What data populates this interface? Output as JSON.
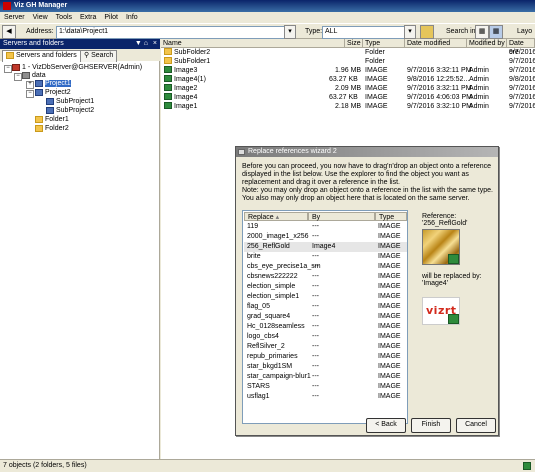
{
  "window": {
    "title": "Viz GH Manager"
  },
  "menu": [
    "Server",
    "View",
    "Tools",
    "Extra",
    "Pilot",
    "Info"
  ],
  "toolbar": {
    "address_label": "Address:",
    "address_value": "1:\\data\\Project1",
    "type_label": "Type:",
    "type_value": "ALL",
    "search_label": "Search in:",
    "layout_label": "Layo"
  },
  "left_panel": {
    "header": "Servers and folders",
    "tabs": [
      "Servers and folders",
      "Search"
    ],
    "tree": [
      {
        "label": "1 - VizDbServer@GHSERVER(Admin)"
      },
      {
        "label": "data"
      },
      {
        "label": "Project1"
      },
      {
        "label": "Project2"
      },
      {
        "label": "SubProject1"
      },
      {
        "label": "SubProject2"
      },
      {
        "label": "Folder1"
      },
      {
        "label": "Folder2"
      }
    ]
  },
  "file_list": {
    "columns": [
      "Name",
      "Size",
      "Type",
      "Date modified",
      "Modified by",
      "Date cre"
    ],
    "rows": [
      {
        "name": "SubFolder2",
        "size": "",
        "type": "Folder",
        "date": "",
        "by": "",
        "created": "9/7/2016"
      },
      {
        "name": "SubFolder1",
        "size": "",
        "type": "Folder",
        "date": "",
        "by": "",
        "created": "9/7/2016"
      },
      {
        "name": "Image3",
        "size": "1.96 MB",
        "type": "IMAGE",
        "date": "9/7/2016 3:32:11 PM",
        "by": "Admin",
        "created": "9/7/2016"
      },
      {
        "name": "Image4(1)",
        "size": "63.27 KB",
        "type": "IMAGE",
        "date": "9/8/2016 12:25:52...",
        "by": "Admin",
        "created": "9/8/2016"
      },
      {
        "name": "Image2",
        "size": "2.09 MB",
        "type": "IMAGE",
        "date": "9/7/2016 3:32:11 PM",
        "by": "Admin",
        "created": "9/7/2016"
      },
      {
        "name": "Image4",
        "size": "63.27 KB",
        "type": "IMAGE",
        "date": "9/7/2016 4:06:03 PM",
        "by": "Admin",
        "created": "9/7/2016"
      },
      {
        "name": "Image1",
        "size": "2.18 MB",
        "type": "IMAGE",
        "date": "9/7/2016 3:32:10 PM",
        "by": "Admin",
        "created": "9/7/2016"
      }
    ]
  },
  "dialog": {
    "title": "Replace references wizard 2",
    "text1": "Before you can proceed, you now have to drag'n'drop an object onto a reference displayed in the list below. Use the explorer to find the object you want as replacement and drag it over a reference in the list.",
    "text2": "Note: you may only drop an object onto a reference in the list with the same type.",
    "text3": "You also may only drop an object here that is located on the same server.",
    "columns": [
      "Replace",
      "By",
      "Type"
    ],
    "rows": [
      {
        "replace": "119",
        "by": "---",
        "type": "IMAGE"
      },
      {
        "replace": "2000_image1_x256",
        "by": "---",
        "type": "IMAGE"
      },
      {
        "replace": "256_ReflGold",
        "by": "Image4",
        "type": "IMAGE"
      },
      {
        "replace": "brite",
        "by": "---",
        "type": "IMAGE"
      },
      {
        "replace": "cbs_eye_precise1a_sm",
        "by": "---",
        "type": "IMAGE"
      },
      {
        "replace": "cbsnews222222",
        "by": "---",
        "type": "IMAGE"
      },
      {
        "replace": "election_simple",
        "by": "---",
        "type": "IMAGE"
      },
      {
        "replace": "election_simple1",
        "by": "---",
        "type": "IMAGE"
      },
      {
        "replace": "flag_05",
        "by": "---",
        "type": "IMAGE"
      },
      {
        "replace": "grad_square4",
        "by": "---",
        "type": "IMAGE"
      },
      {
        "replace": "Hc_0128seamless",
        "by": "---",
        "type": "IMAGE"
      },
      {
        "replace": "logo_cbs4",
        "by": "---",
        "type": "IMAGE"
      },
      {
        "replace": "ReflSilver_2",
        "by": "---",
        "type": "IMAGE"
      },
      {
        "replace": "repub_primaries",
        "by": "---",
        "type": "IMAGE"
      },
      {
        "replace": "star_bkgd1SM",
        "by": "---",
        "type": "IMAGE"
      },
      {
        "replace": "star_campaign-blur1",
        "by": "---",
        "type": "IMAGE"
      },
      {
        "replace": "STARS",
        "by": "---",
        "type": "IMAGE"
      },
      {
        "replace": "usflag1",
        "by": "---",
        "type": "IMAGE"
      }
    ],
    "reference_label": "Reference:",
    "reference_name": "'256_ReflGold'",
    "replaced_by_label": "will be replaced by:",
    "replaced_by_name": "'Image4'",
    "logo_text": "vizrt",
    "buttons": {
      "back": "< Back",
      "finish": "Finish",
      "cancel": "Cancel"
    }
  },
  "status": "7 objects (2 folders, 5 files)"
}
